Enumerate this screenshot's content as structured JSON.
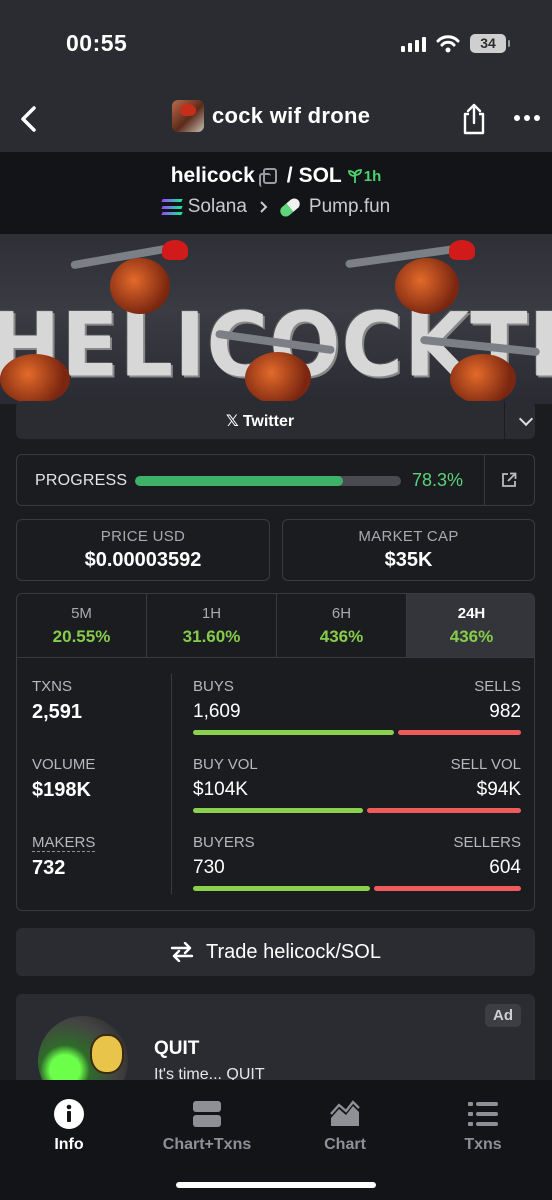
{
  "status": {
    "time": "00:55",
    "battery": "34"
  },
  "nav": {
    "title": "cock wif drone"
  },
  "pair": {
    "base": "helicock",
    "sep": "/",
    "quote": "SOL",
    "age": "1h",
    "chain": "Solana",
    "dex": "Pump.fun"
  },
  "banner": {
    "text": "HELICOCKTER"
  },
  "social": {
    "twitter_label": "Twitter"
  },
  "progress": {
    "label": "PROGRESS",
    "value": "78.3%",
    "fraction": 0.783
  },
  "price": {
    "label": "PRICE USD",
    "value": "$0.00003592"
  },
  "mcap": {
    "label": "MARKET CAP",
    "value": "$35K"
  },
  "timeframes": [
    {
      "label": "5M",
      "change": "20.55%"
    },
    {
      "label": "1H",
      "change": "31.60%"
    },
    {
      "label": "6H",
      "change": "436%"
    },
    {
      "label": "24H",
      "change": "436%"
    }
  ],
  "txns": {
    "txns_label": "TXNS",
    "txns": "2,591",
    "volume_label": "VOLUME",
    "volume": "$198K",
    "makers_label": "MAKERS",
    "makers": "732",
    "buys_label": "BUYS",
    "buys": "1,609",
    "sells_label": "SELLS",
    "sells": "982",
    "buys_fraction": 0.621,
    "buyvol_label": "BUY VOL",
    "buyvol": "$104K",
    "sellvol_label": "SELL VOL",
    "sellvol": "$94K",
    "buyvol_fraction": 0.525,
    "buyers_label": "BUYERS",
    "buyers": "730",
    "sellers_label": "SELLERS",
    "sellers": "604",
    "buyers_fraction": 0.547
  },
  "trade": {
    "label": "Trade helicock/SOL"
  },
  "ad": {
    "badge": "Ad",
    "title": "QUIT",
    "subtitle": "It's time... QUIT"
  },
  "tabs": [
    {
      "label": "Info",
      "icon": "info-icon"
    },
    {
      "label": "Chart+Txns",
      "icon": "split-view-icon"
    },
    {
      "label": "Chart",
      "icon": "chart-icon"
    },
    {
      "label": "Txns",
      "icon": "list-icon"
    }
  ],
  "colors": {
    "green": "#86cc4a",
    "red": "#ef5b5b",
    "progress": "#3fb26a",
    "background": "#1b1c20"
  }
}
